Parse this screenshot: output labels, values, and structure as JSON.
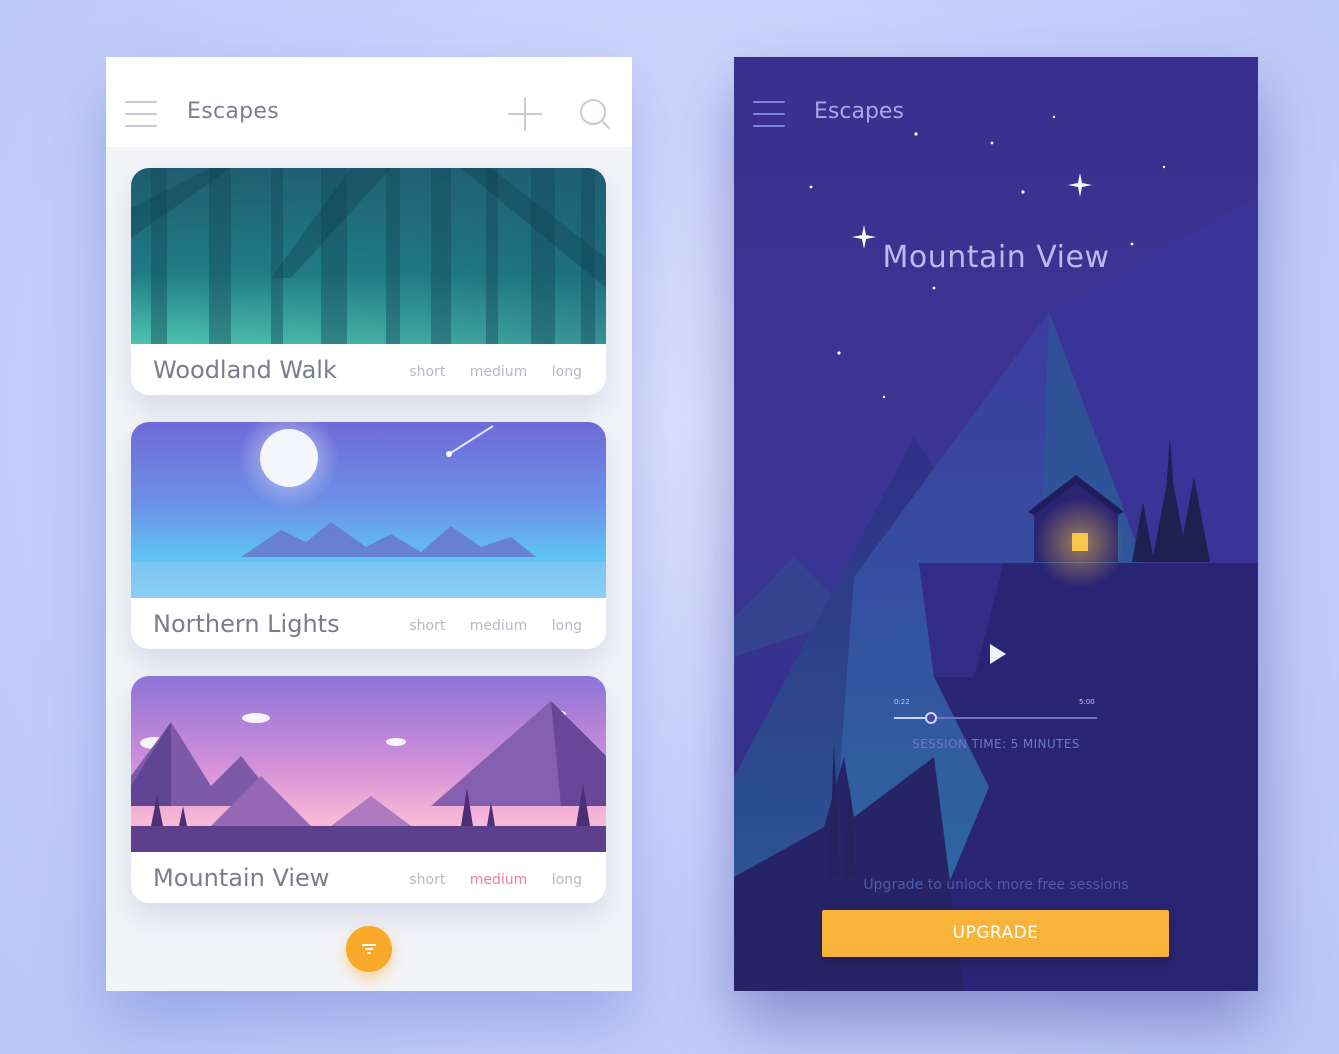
{
  "left_screen": {
    "title": "Escapes",
    "cards": [
      {
        "name": "Woodland Walk",
        "durations": [
          "short",
          "medium",
          "long"
        ],
        "selected": null
      },
      {
        "name": "Northern Lights",
        "durations": [
          "short",
          "medium",
          "long"
        ],
        "selected": null
      },
      {
        "name": "Mountain View",
        "durations": [
          "short",
          "medium",
          "long"
        ],
        "selected": "medium"
      }
    ]
  },
  "right_screen": {
    "title": "Escapes",
    "scene_title": "Mountain View",
    "time_start": "0:22",
    "time_end": "5:00",
    "progress_fraction": 0.18,
    "session_label": "SESSION TIME: 5 MINUTES",
    "upgrade_prompt": "Upgrade to unlock more free sessions",
    "upgrade_label": "UPGRADE"
  },
  "colors": {
    "accent": "#f8b43a",
    "fab": "#f8a92a",
    "selected_duration": "#f17d97",
    "night_bg": "#3b3390"
  },
  "icons": [
    "menu-icon",
    "plus-icon",
    "search-icon",
    "filter-icon",
    "play-icon"
  ]
}
